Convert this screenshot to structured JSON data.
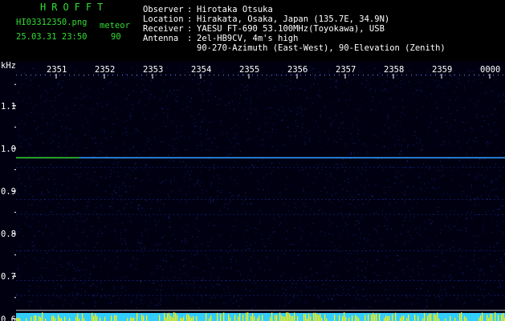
{
  "header": {
    "brand": "HROFFT",
    "filename": "HI03312350.png",
    "mode_label": "meteor",
    "datetime": "25.03.31 23:50",
    "count": "90",
    "fields": [
      {
        "label": "Observer",
        "sep": ":",
        "value": "Hirotaka Otsuka"
      },
      {
        "label": "Location",
        "sep": ":",
        "value": "Hirakata, Osaka, Japan (135.7E, 34.9N)"
      },
      {
        "label": "Receiver",
        "sep": ":",
        "value": "YAESU FT-690 53.100MHz(Toyokawa), USB"
      },
      {
        "label": "Antenna",
        "sep": ":",
        "value": "2el-HB9CV, 4m's high"
      }
    ],
    "antenna_extra": [
      "90-270-Azimuth (East-West), 90-Elevation (Zenith)"
    ]
  },
  "chart_data": {
    "type": "heatmap",
    "ylabel": "kHz",
    "x_ticks": [
      "2351",
      "2352",
      "2353",
      "2354",
      "2355",
      "2356",
      "2357",
      "2358",
      "2359",
      "0000"
    ],
    "y_ticks": [
      "1.1",
      "1.0",
      "0.9",
      "0.8",
      "0.7",
      "0.6"
    ],
    "y_tick_values": [
      1.1,
      1.0,
      0.9,
      0.8,
      0.7,
      0.6
    ],
    "ylim": [
      0.595,
      1.205
    ],
    "signals": [
      {
        "freq_khz": 0.978,
        "color": "#33cc33",
        "extent": [
          0.0,
          0.13
        ]
      },
      {
        "freq_khz": 0.978,
        "color": "#3399ff",
        "extent": [
          0.13,
          1.0
        ]
      }
    ],
    "reference_lines_khz": [
      0.62,
      0.606
    ],
    "colors": {
      "background": "#000011",
      "noise": "#2233aa",
      "bottom_band": "#33ccff",
      "bottom_spikes": "#ffee00"
    }
  }
}
